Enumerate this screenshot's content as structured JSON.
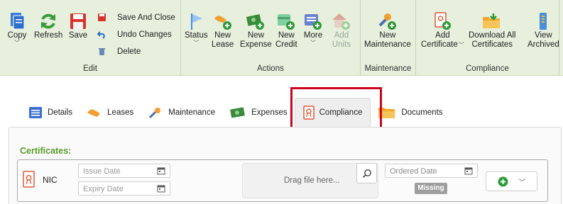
{
  "ribbon": {
    "edit": {
      "label": "Edit",
      "copy": "Copy",
      "refresh": "Refresh",
      "save": "Save",
      "save_and_close": "Save And Close",
      "undo_changes": "Undo Changes",
      "delete": "Delete"
    },
    "actions": {
      "label": "Actions",
      "status": "Status",
      "new_lease_1": "New",
      "new_lease_2": "Lease",
      "new_expense_1": "New",
      "new_expense_2": "Expense",
      "new_credit_1": "New",
      "new_credit_2": "Credit",
      "more": "More",
      "add_units_1": "Add",
      "add_units_2": "Units"
    },
    "maintenance": {
      "label": "Maintenance",
      "new_maintenance_1": "New",
      "new_maintenance_2": "Maintenance"
    },
    "compliance": {
      "label": "Compliance",
      "add_certificate_1": "Add",
      "add_certificate_2": "Certificate",
      "download_all_1": "Download All",
      "download_all_2": "Certificates",
      "view_archived_1": "View",
      "view_archived_2": "Archived"
    }
  },
  "tabs": [
    "Details",
    "Leases",
    "Maintenance",
    "Expenses",
    "Compliance",
    "Documents"
  ],
  "certificates": {
    "heading": "Certificates:",
    "row": {
      "name": "NIC",
      "issue_date_placeholder": "Issue Date",
      "expiry_date_placeholder": "Expiry Date",
      "drop_text": "Drag file here...",
      "ordered_date_placeholder": "Ordered Date",
      "status": "Missing"
    }
  },
  "colors": {
    "ribbon_bg": "#e6f0dc",
    "accent_green": "#5a9a28",
    "highlight_red": "#d0021b",
    "badge_gray": "#9e9e9e"
  }
}
